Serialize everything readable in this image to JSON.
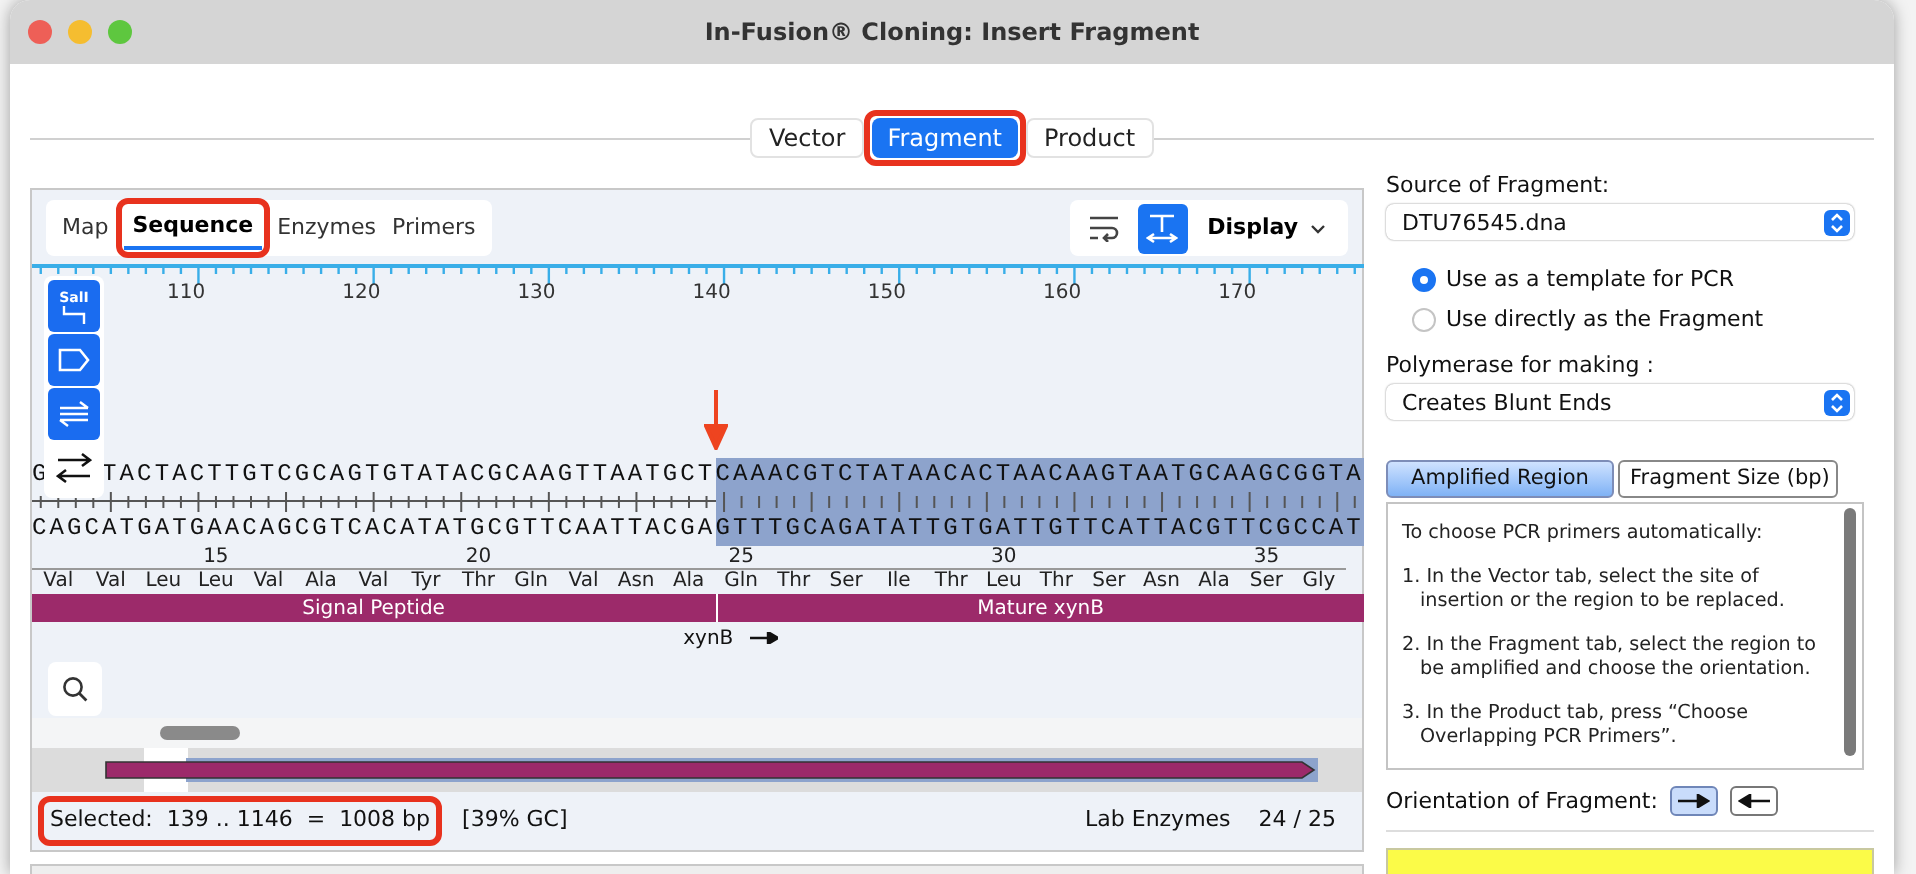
{
  "window": {
    "title": "In-Fusion® Cloning: Insert Fragment"
  },
  "main_tabs": [
    {
      "label": "Vector",
      "selected": false,
      "highlighted": false
    },
    {
      "label": "Fragment",
      "selected": true,
      "highlighted": true
    },
    {
      "label": "Product",
      "selected": false,
      "highlighted": false
    }
  ],
  "view_tabs": [
    {
      "label": "Map",
      "selected": false,
      "highlighted": false
    },
    {
      "label": "Sequence",
      "selected": true,
      "highlighted": true
    },
    {
      "label": "Enzymes",
      "selected": false,
      "highlighted": false
    },
    {
      "label": "Primers",
      "selected": false,
      "highlighted": false
    }
  ],
  "view_toolbar": {
    "buttons": [
      {
        "kind": "wrap",
        "on": false
      },
      {
        "kind": "fit",
        "on": true
      }
    ],
    "display_label": "Display"
  },
  "side_tools": [
    {
      "kind": "enzyme",
      "label": "SalI",
      "on": true
    },
    {
      "kind": "feature",
      "on": true
    },
    {
      "kind": "primer",
      "on": true
    },
    {
      "kind": "translate",
      "on": false
    }
  ],
  "sequence": {
    "ruler": [
      "110",
      "120",
      "130",
      "140",
      "150",
      "160",
      "170"
    ],
    "top_strand": {
      "lead": "G",
      "plain": "TACTACTTGTCGCAGTGTATACGCAAGTTAATGCT",
      "selected": "CAAACGTCTATAACACTAACAAGTAATGCAAGCGGTA"
    },
    "bottom_strand": {
      "plain": "CAGCATGATGAACAGCGTCACATATGCGTTCAATTACGA",
      "selected": "GTTTGCAGATATTGTGATTGTTCATTACGTTCGCCAT"
    },
    "amino_acids": [
      {
        "name": "Val"
      },
      {
        "name": "Val"
      },
      {
        "name": "Leu"
      },
      {
        "name": "Leu",
        "number": "15"
      },
      {
        "name": "Val"
      },
      {
        "name": "Ala"
      },
      {
        "name": "Val"
      },
      {
        "name": "Tyr"
      },
      {
        "name": "Thr",
        "number": "20"
      },
      {
        "name": "Gln"
      },
      {
        "name": "Val"
      },
      {
        "name": "Asn"
      },
      {
        "name": "Ala"
      },
      {
        "name": "Gln",
        "number": "25"
      },
      {
        "name": "Thr"
      },
      {
        "name": "Ser"
      },
      {
        "name": "Ile"
      },
      {
        "name": "Thr"
      },
      {
        "name": "Leu",
        "number": "30"
      },
      {
        "name": "Thr"
      },
      {
        "name": "Ser"
      },
      {
        "name": "Asn"
      },
      {
        "name": "Ala"
      },
      {
        "name": "Ser",
        "number": "35"
      },
      {
        "name": "Gly"
      }
    ],
    "features": [
      {
        "label": "Signal Peptide",
        "color": "#9c2a6a"
      },
      {
        "label": "Mature xynB",
        "color": "#9c2a6a"
      }
    ],
    "gene": {
      "label": "xynB"
    }
  },
  "status": {
    "selection": "Selected:  139 .. 1146  =  1008 bp",
    "highlighted": true,
    "gc": "[39% GC]",
    "enzyme_set": "Lab Enzymes",
    "enzyme_count": "24 / 25"
  },
  "source": {
    "label": "Source of Fragment:",
    "value": "DTU76545.dna"
  },
  "use_options": [
    {
      "label": "Use as a template for PCR",
      "selected": true
    },
    {
      "label": "Use directly as the Fragment",
      "selected": false
    }
  ],
  "polymerase": {
    "label": "Polymerase for making :",
    "value": "Creates Blunt Ends"
  },
  "info_tabs": [
    {
      "label": "Amplified Region",
      "selected": true
    },
    {
      "label": "Fragment Size (bp)",
      "selected": false
    }
  ],
  "instructions": [
    "To choose PCR primers automatically:",
    "1. In the Vector tab, select the site of insertion or the region to be replaced.",
    "2. In the Fragment tab, select the region to be amplified and choose the orientation.",
    "3. In the Product tab, press “Choose Overlapping PCR Primers”."
  ],
  "orientation": {
    "label": "Orientation of Fragment:",
    "options": [
      {
        "kind": "forward",
        "selected": true
      },
      {
        "kind": "reverse",
        "selected": false
      }
    ]
  }
}
